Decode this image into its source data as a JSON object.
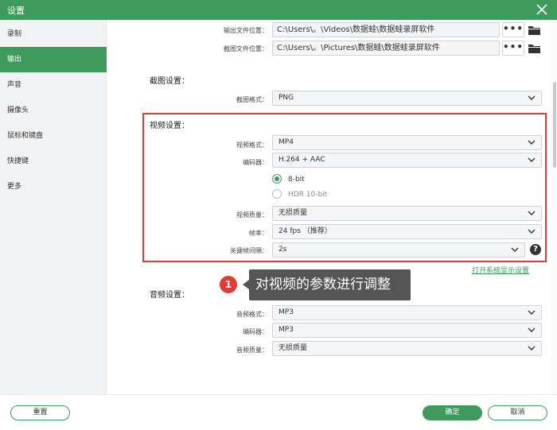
{
  "window": {
    "title": "设置"
  },
  "sidebar": {
    "items": [
      {
        "label": "录制"
      },
      {
        "label": "输出"
      },
      {
        "label": "声音"
      },
      {
        "label": "摄像头"
      },
      {
        "label": "鼠标和键盘"
      },
      {
        "label": "快捷键"
      },
      {
        "label": "更多"
      }
    ],
    "active_index": 1
  },
  "output": {
    "output_folder_label": "输出文件位置：",
    "output_folder_value": "C:\\Users\\。\\Videos\\数据蛙\\数据蛙录屏软件",
    "screenshot_folder_label": "截图文件位置：",
    "screenshot_folder_value": "C:\\Users\\。\\Pictures\\数据蛙\\数据蛙录屏软件",
    "browse_label": "•••"
  },
  "screenshot_settings": {
    "title": "截图设置：",
    "format_label": "截图格式：",
    "format_value": "PNG"
  },
  "video_settings": {
    "title": "视频设置：",
    "format_label": "视频格式：",
    "format_value": "MP4",
    "encoder_label": "编码器：",
    "encoder_value": "H.264 + AAC",
    "bit_8_label": "8-bit",
    "bit_hdr_label": "HDR 10-bit",
    "quality_label": "视频质量：",
    "quality_value": "无损质量",
    "fps_label": "帧率：",
    "fps_value": "24 fps （推荐）",
    "keyframe_label": "关键帧间隔：",
    "keyframe_value": "2s",
    "help_label": "?",
    "display_settings_link": "打开系统显示设置"
  },
  "annotation": {
    "number": "1",
    "text": "对视频的参数进行调整",
    "highlight_color": "#e53935"
  },
  "audio_settings": {
    "title": "音频设置：",
    "format_label": "音频格式：",
    "format_value": "MP3",
    "encoder_label": "编码器：",
    "encoder_value": "MP3",
    "quality_label": "音频质量：",
    "quality_value": "无损质量"
  },
  "footer": {
    "reset_label": "重置",
    "ok_label": "确定",
    "cancel_label": "取消"
  },
  "colors": {
    "accent": "#3e9a5d",
    "sidebar_bg": "#f2f3f5",
    "callout_bg": "#555555"
  }
}
